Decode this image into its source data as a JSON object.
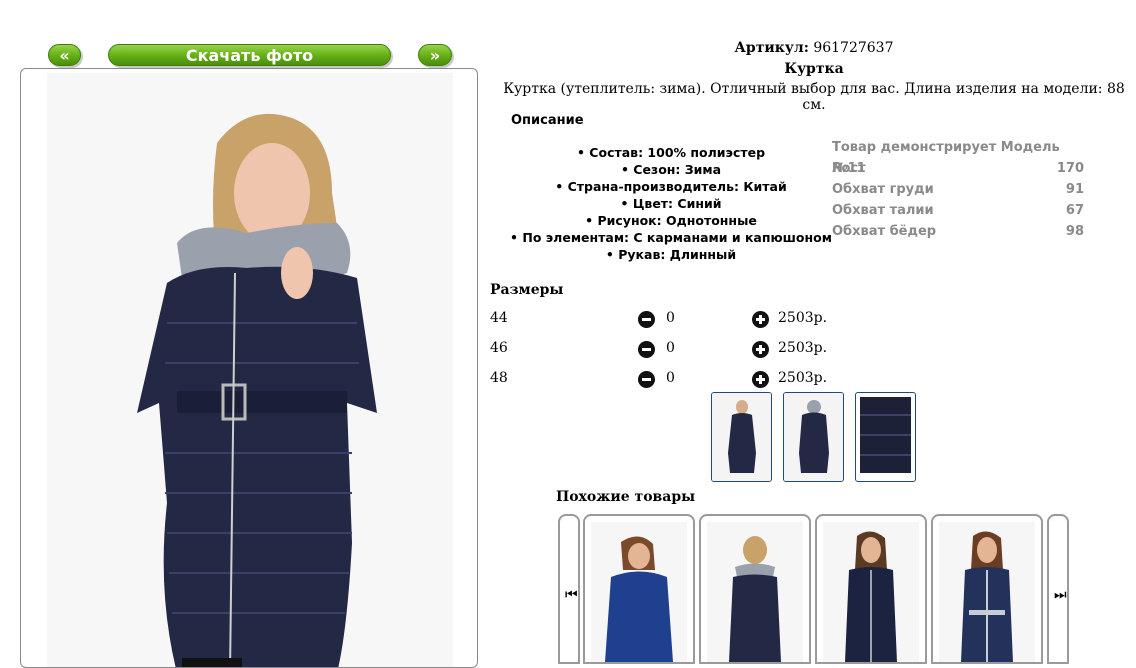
{
  "nav": {
    "prev_label": "«",
    "download_label": "Скачать фото",
    "next_label": "»"
  },
  "product": {
    "sku_label": "Артикул:",
    "sku_value": "961727637",
    "name": "Куртка",
    "description": "Куртка (утеплитель: зима). Отличный выбор для вас. Длина изделия на модели: 88 см."
  },
  "description_title": "Описание",
  "properties": [
    "• Состав: 100% полиэстер",
    "• Сезон: Зима",
    "• Страна-производитель: Китай",
    "• Цвет: Синий",
    "• Рисунок: Однотонные",
    "• По элементам: С карманами и капюшоном",
    "• Рукав: Длинный"
  ],
  "model": {
    "title": "Товар демонстрирует Модель №11",
    "rows": [
      {
        "label": "Рост",
        "value": "170"
      },
      {
        "label": "Обхват груди",
        "value": "91"
      },
      {
        "label": "Обхват талии",
        "value": "67"
      },
      {
        "label": "Обхват бёдер",
        "value": "98"
      }
    ]
  },
  "sizes_title": "Размеры",
  "sizes": [
    {
      "size": "44",
      "qty": "0",
      "price": "2503р."
    },
    {
      "size": "46",
      "qty": "0",
      "price": "2503р."
    },
    {
      "size": "48",
      "qty": "0",
      "price": "2503р."
    }
  ],
  "similar_title": "Похожие товары",
  "colors": {
    "accent_green": "#6cb51a",
    "coat_navy": "#1f2440",
    "thumb_border": "#1d4a7a"
  }
}
